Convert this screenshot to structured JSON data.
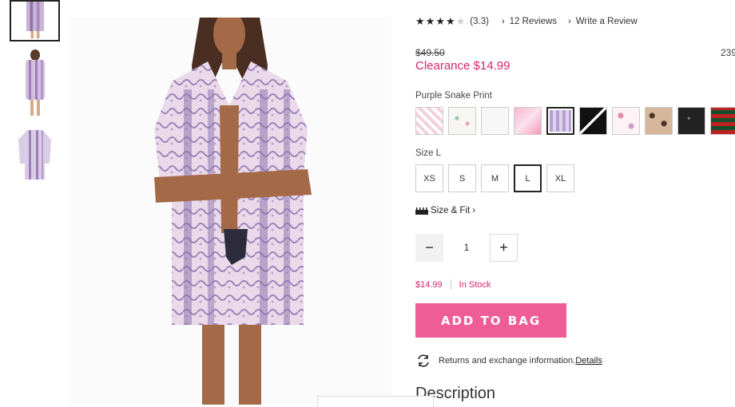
{
  "rating": {
    "value_text": "(3.3)",
    "stars": [
      "full",
      "full",
      "full",
      "half",
      "empty"
    ],
    "reviews_link": "12 Reviews",
    "write_review_link": "Write a Review"
  },
  "price": {
    "original": "$49.50",
    "sale": "Clearance $14.99",
    "right_count": "239"
  },
  "color": {
    "selected_name": "Purple Snake Print",
    "swatch_names": [
      "pink-plaid",
      "white-floral",
      "white-solid",
      "pink-marble",
      "purple-snake",
      "black-stripe",
      "white-pattern",
      "leopard-print",
      "black-sparkle",
      "red-plaid"
    ],
    "selected_index": 4
  },
  "size": {
    "label": "Size L",
    "options": [
      "XS",
      "S",
      "M",
      "L",
      "XL"
    ],
    "selected": "L",
    "fit_link": "Size & Fit"
  },
  "quantity": {
    "value": "1",
    "minus_symbol": "−",
    "plus_symbol": "+"
  },
  "stock": {
    "price": "$14.99",
    "status": "In Stock"
  },
  "cta": {
    "add_to_bag": "ADD TO BAG"
  },
  "returns": {
    "text": "Returns and exchange information.",
    "details_link": "Details"
  },
  "description": {
    "heading": "Description"
  },
  "colors": {
    "accent_pink": "#d6246e",
    "button_pink": "#ee5d96"
  }
}
